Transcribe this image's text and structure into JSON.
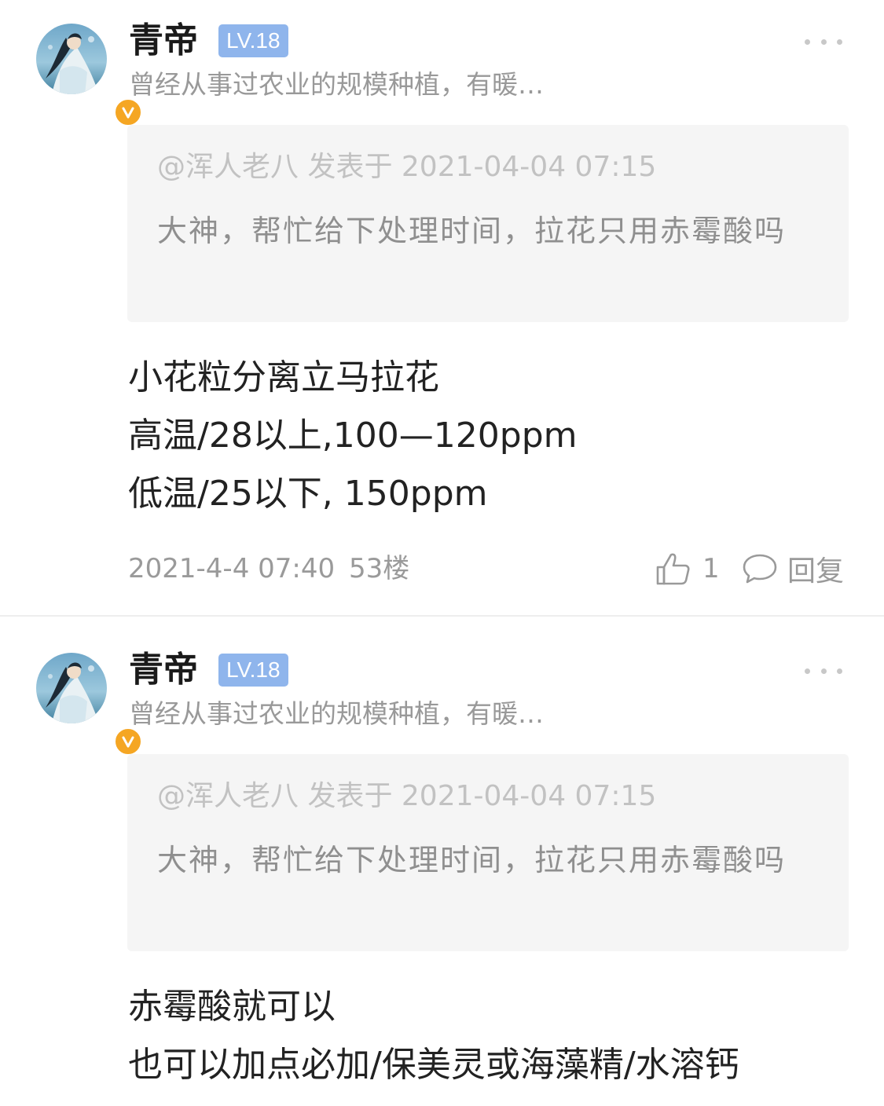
{
  "colors": {
    "level_badge_bg": "#8fb5ec",
    "verified_badge": "#f5a623",
    "quote_bg": "#f5f5f5",
    "secondary_text": "#999999"
  },
  "posts": [
    {
      "user": {
        "name": "青帝",
        "level": "LV.18",
        "bio": "曾经从事过农业的规模种植，有暖…",
        "verified_icon": "v-verified-icon"
      },
      "quote": {
        "meta": "@浑人老八 发表于 2021-04-04 07:15",
        "text": "大神，帮忙给下处理时间，拉花只用赤霉酸吗"
      },
      "content": [
        "小花粒分离立马拉花",
        "高温/28以上,100—120ppm",
        "低温/25以下, 150ppm"
      ],
      "footer": {
        "time": "2021-4-4 07:40",
        "floor": "53楼",
        "like_count": "1",
        "reply_label": "回复"
      }
    },
    {
      "user": {
        "name": "青帝",
        "level": "LV.18",
        "bio": "曾经从事过农业的规模种植，有暖…",
        "verified_icon": "v-verified-icon"
      },
      "quote": {
        "meta": "@浑人老八 发表于 2021-04-04 07:15",
        "text": "大神，帮忙给下处理时间，拉花只用赤霉酸吗"
      },
      "content": [
        "赤霉酸就可以",
        "也可以加点必加/保美灵或海藻精/水溶钙"
      ]
    }
  ]
}
